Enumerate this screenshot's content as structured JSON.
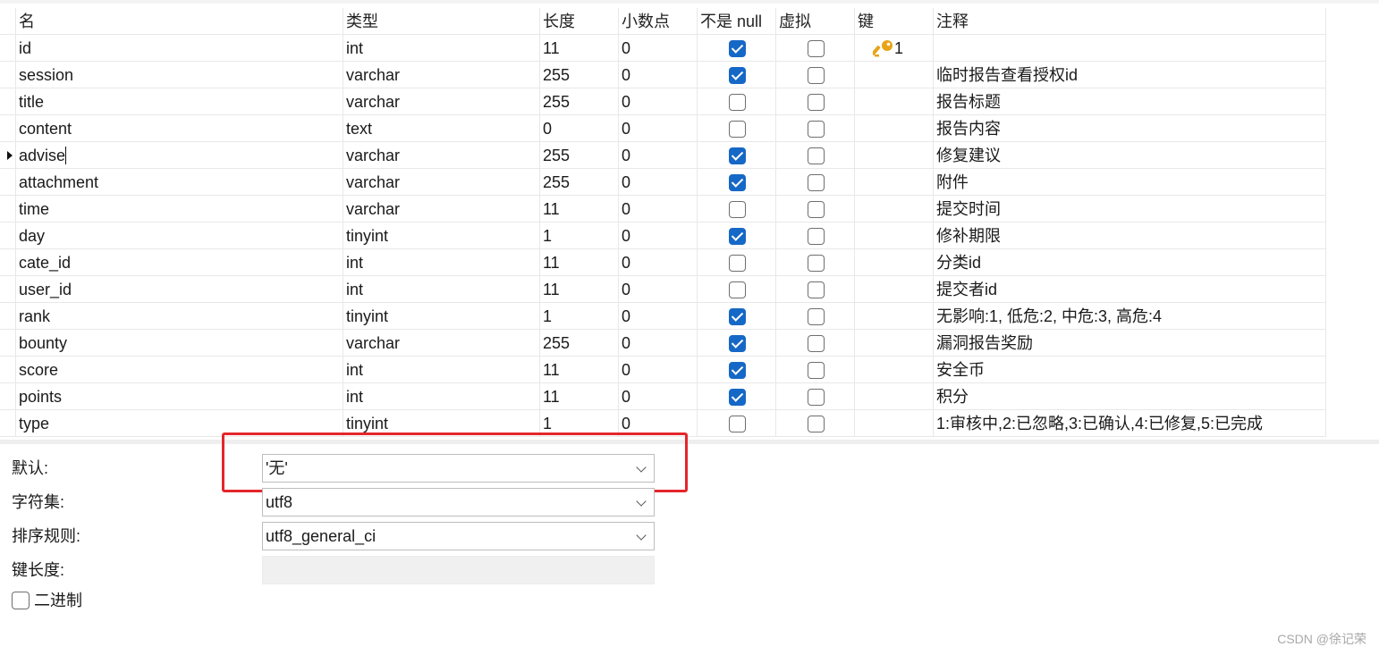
{
  "columns": [
    "名",
    "类型",
    "长度",
    "小数点",
    "不是 null",
    "虚拟",
    "键",
    "注释"
  ],
  "fields": [
    {
      "name": "id",
      "type": "int",
      "length": "11",
      "decimals": "0",
      "not_null": true,
      "virtual": false,
      "key": "1",
      "comment": ""
    },
    {
      "name": "session",
      "type": "varchar",
      "length": "255",
      "decimals": "0",
      "not_null": true,
      "virtual": false,
      "key": "",
      "comment": "临时报告查看授权id"
    },
    {
      "name": "title",
      "type": "varchar",
      "length": "255",
      "decimals": "0",
      "not_null": false,
      "virtual": false,
      "key": "",
      "comment": "报告标题"
    },
    {
      "name": "content",
      "type": "text",
      "length": "0",
      "decimals": "0",
      "not_null": false,
      "virtual": false,
      "key": "",
      "comment": "报告内容"
    },
    {
      "name": "advise",
      "type": "varchar",
      "length": "255",
      "decimals": "0",
      "not_null": true,
      "virtual": false,
      "key": "",
      "comment": "修复建议",
      "selected": true
    },
    {
      "name": "attachment",
      "type": "varchar",
      "length": "255",
      "decimals": "0",
      "not_null": true,
      "virtual": false,
      "key": "",
      "comment": "附件"
    },
    {
      "name": "time",
      "type": "varchar",
      "length": "11",
      "decimals": "0",
      "not_null": false,
      "virtual": false,
      "key": "",
      "comment": "提交时间"
    },
    {
      "name": "day",
      "type": "tinyint",
      "length": "1",
      "decimals": "0",
      "not_null": true,
      "virtual": false,
      "key": "",
      "comment": "修补期限"
    },
    {
      "name": "cate_id",
      "type": "int",
      "length": "11",
      "decimals": "0",
      "not_null": false,
      "virtual": false,
      "key": "",
      "comment": "分类id"
    },
    {
      "name": "user_id",
      "type": "int",
      "length": "11",
      "decimals": "0",
      "not_null": false,
      "virtual": false,
      "key": "",
      "comment": "提交者id"
    },
    {
      "name": "rank",
      "type": "tinyint",
      "length": "1",
      "decimals": "0",
      "not_null": true,
      "virtual": false,
      "key": "",
      "comment": "无影响:1, 低危:2, 中危:3, 高危:4"
    },
    {
      "name": "bounty",
      "type": "varchar",
      "length": "255",
      "decimals": "0",
      "not_null": true,
      "virtual": false,
      "key": "",
      "comment": "漏洞报告奖励"
    },
    {
      "name": "score",
      "type": "int",
      "length": "11",
      "decimals": "0",
      "not_null": true,
      "virtual": false,
      "key": "",
      "comment": "安全币"
    },
    {
      "name": "points",
      "type": "int",
      "length": "11",
      "decimals": "0",
      "not_null": true,
      "virtual": false,
      "key": "",
      "comment": "积分"
    },
    {
      "name": "type",
      "type": "tinyint",
      "length": "1",
      "decimals": "0",
      "not_null": false,
      "virtual": false,
      "key": "",
      "comment": "1:审核中,2:已忽略,3:已确认,4:已修复,5:已完成"
    }
  ],
  "properties": {
    "default_label": "默认:",
    "default_value": "'无'",
    "charset_label": "字符集:",
    "charset_value": "utf8",
    "collation_label": "排序规则:",
    "collation_value": "utf8_general_ci",
    "key_length_label": "键长度:",
    "binary_label": "二进制"
  },
  "watermark": "CSDN @徐记荣",
  "colors": {
    "checkbox_checked": "#1668c6",
    "highlight_border": "#e4262b",
    "key_icon": "#e8a317"
  }
}
